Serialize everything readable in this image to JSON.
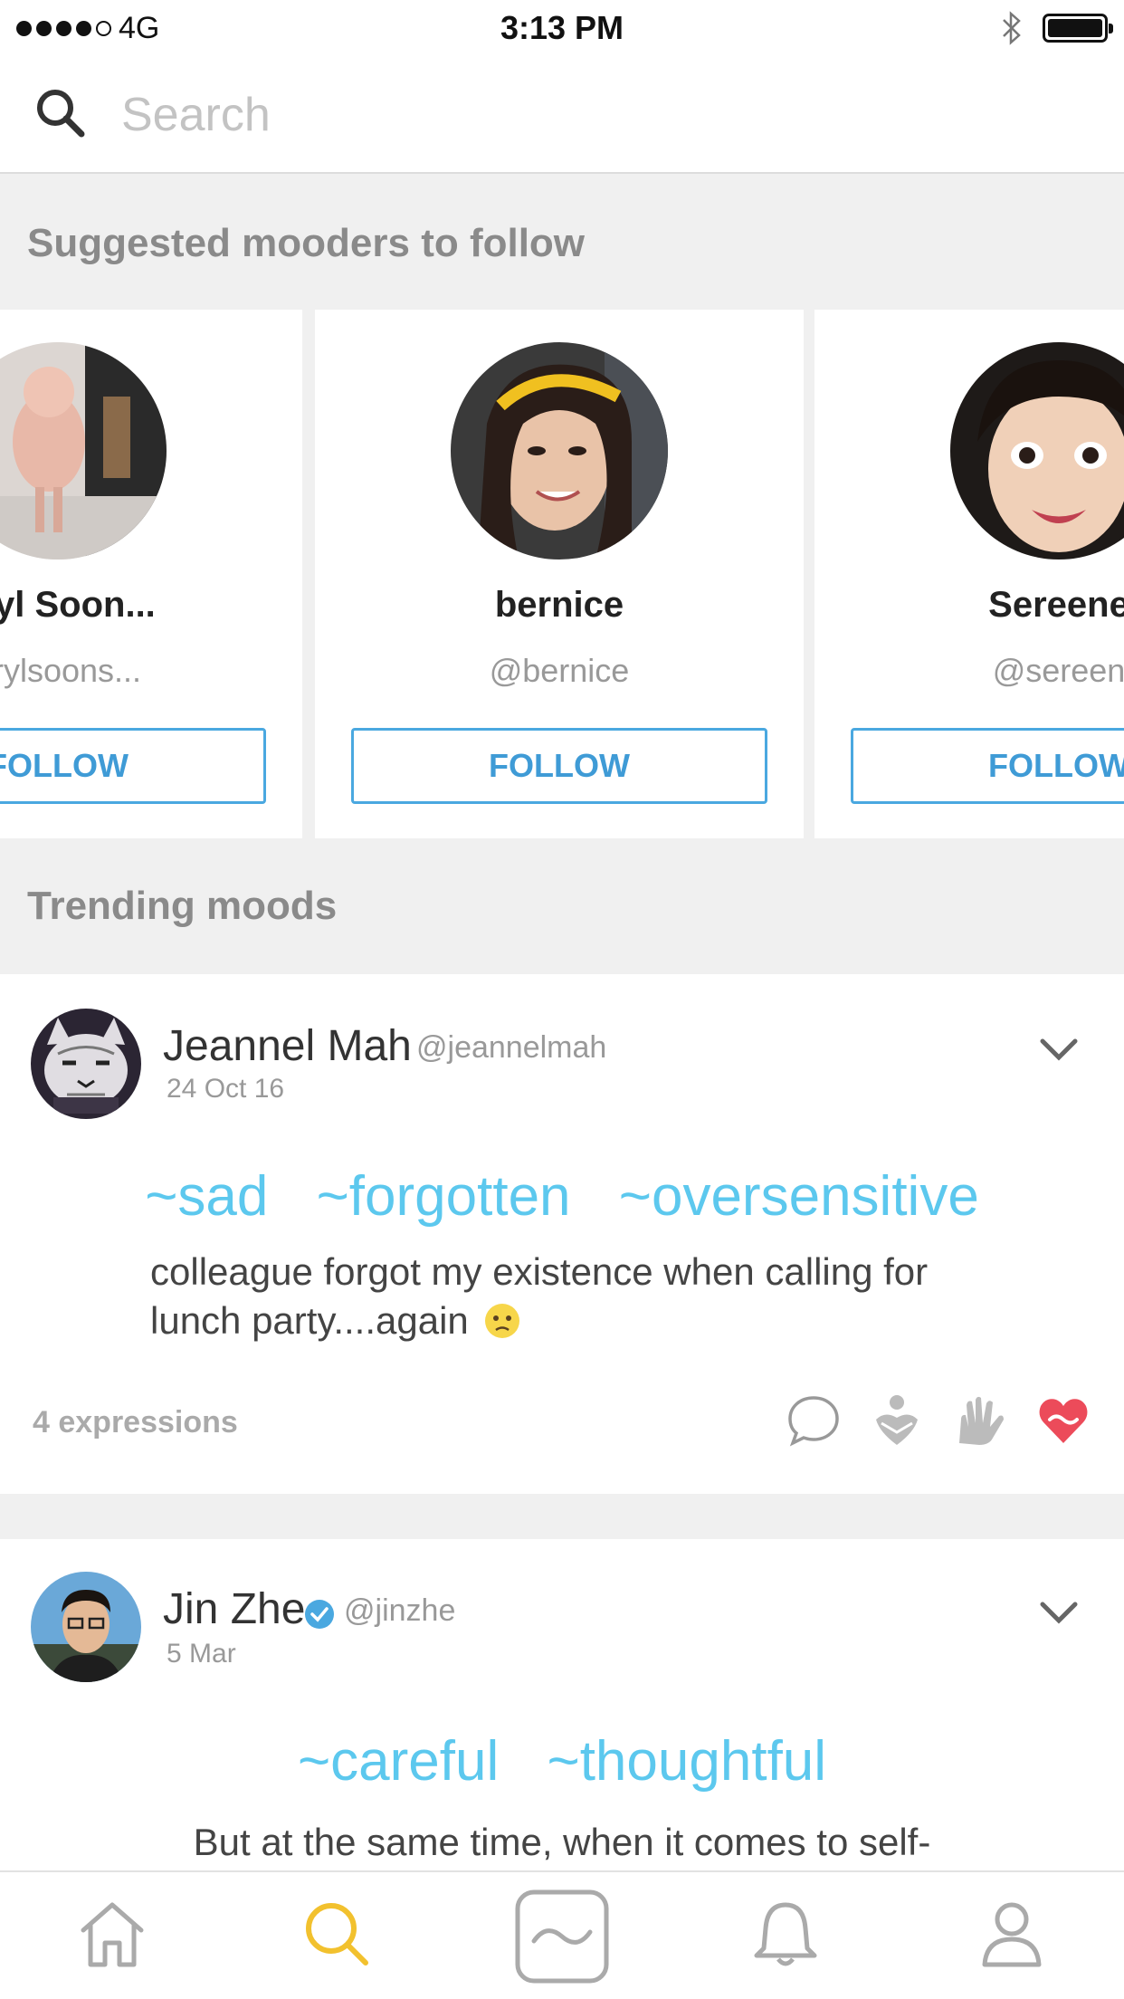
{
  "status_bar": {
    "carrier": "4G",
    "time": "3:13 PM",
    "signal_bars": 4
  },
  "search": {
    "placeholder": "Search",
    "value": ""
  },
  "suggested": {
    "title": "Suggested mooders to follow",
    "users": [
      {
        "name": "eryl Soon...",
        "handle": "erylsoons...",
        "follow_label": "FOLLOW"
      },
      {
        "name": "bernice",
        "handle": "@bernice",
        "follow_label": "FOLLOW"
      },
      {
        "name": "Sereene",
        "handle": "@sereen",
        "follow_label": "FOLLOW"
      }
    ]
  },
  "trending": {
    "title": "Trending moods"
  },
  "posts": [
    {
      "name": "Jeannel Mah",
      "handle": "@jeannelmah",
      "date": "24 Oct 16",
      "moods": [
        "~sad",
        "~forgotten",
        "~oversensitive"
      ],
      "text": "colleague forgot my existence when calling for lunch party....again",
      "expressions": "4 expressions"
    },
    {
      "name": "Jin Zhe",
      "handle": "@jinzhe",
      "date": "5 Mar",
      "verified": true,
      "moods": [
        "~careful",
        "~thoughtful"
      ],
      "text": "But at the same time, when it comes to self-"
    }
  ],
  "nav": {
    "tabs": [
      "home",
      "search",
      "mood",
      "notifications",
      "profile"
    ],
    "active": "search"
  },
  "colors": {
    "accent": "#5cc8ee",
    "follow": "#3f9bd6",
    "active_tab": "#f2c12e",
    "heart": "#ec4b5a"
  }
}
